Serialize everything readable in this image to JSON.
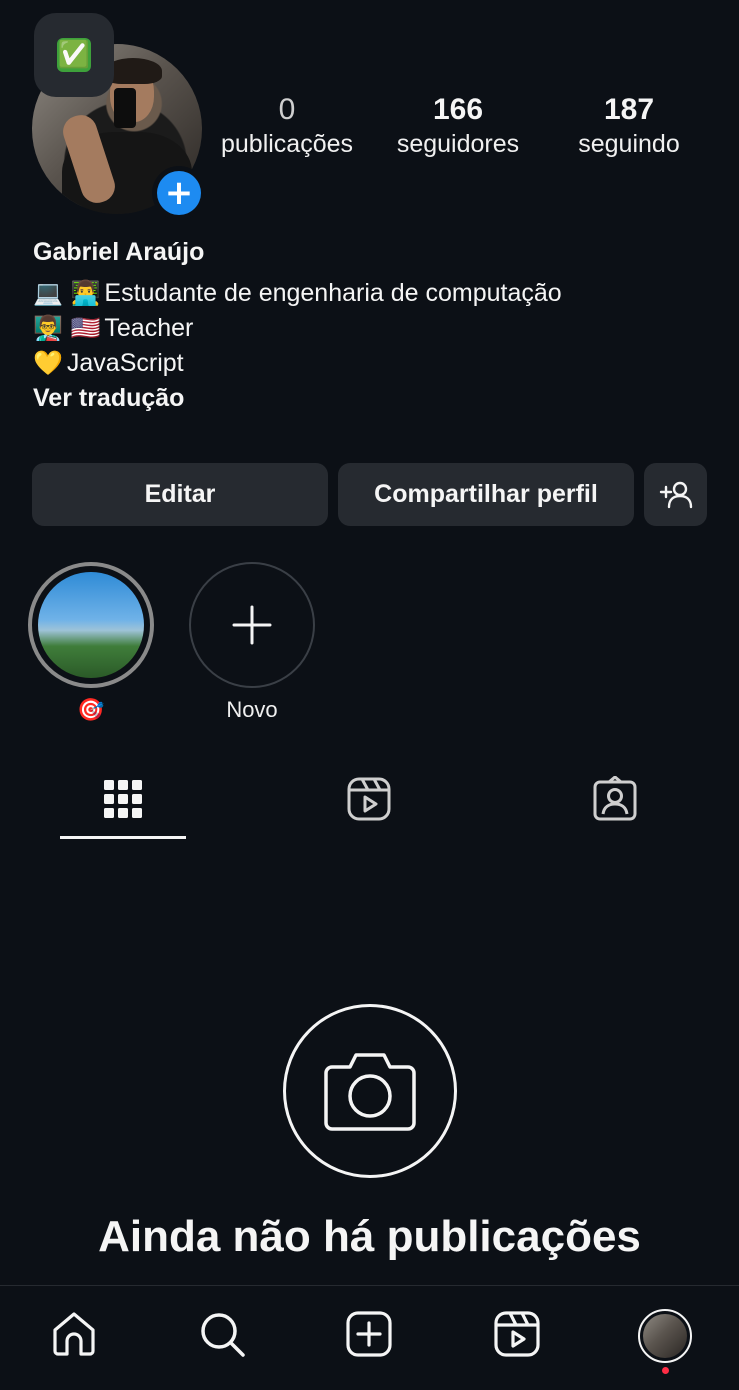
{
  "profile": {
    "name": "Gabriel Araújo",
    "note_emoji": "✅",
    "stats": [
      {
        "value": "0",
        "label": "publicações"
      },
      {
        "value": "166",
        "label": "seguidores"
      },
      {
        "value": "187",
        "label": "seguindo"
      }
    ],
    "bio": [
      {
        "emoji": "💻 👨‍💻",
        "text": "Estudante de engenharia de computação"
      },
      {
        "emoji": "👨‍🏫 🇺🇸",
        "text": "Teacher"
      },
      {
        "emoji": "💛",
        "text": "JavaScript"
      }
    ],
    "translate_label": "Ver tradução"
  },
  "actions": {
    "edit_label": "Editar",
    "share_label": "Compartilhar perfil"
  },
  "highlights": [
    {
      "label": "🎯"
    },
    {
      "label": "Novo"
    }
  ],
  "tabs": [
    {
      "icon": "grid-icon",
      "active": true
    },
    {
      "icon": "reels-icon",
      "active": false
    },
    {
      "icon": "tagged-icon",
      "active": false
    }
  ],
  "empty_state": {
    "title": "Ainda não há publicações"
  },
  "bottom_nav": [
    "home-icon",
    "search-icon",
    "create-icon",
    "reels-icon",
    "profile-avatar"
  ],
  "colors": {
    "background": "#0c1016",
    "button": "#262a30",
    "accent_blue": "#1d8bf1",
    "notification_dot": "#ff2d45"
  }
}
